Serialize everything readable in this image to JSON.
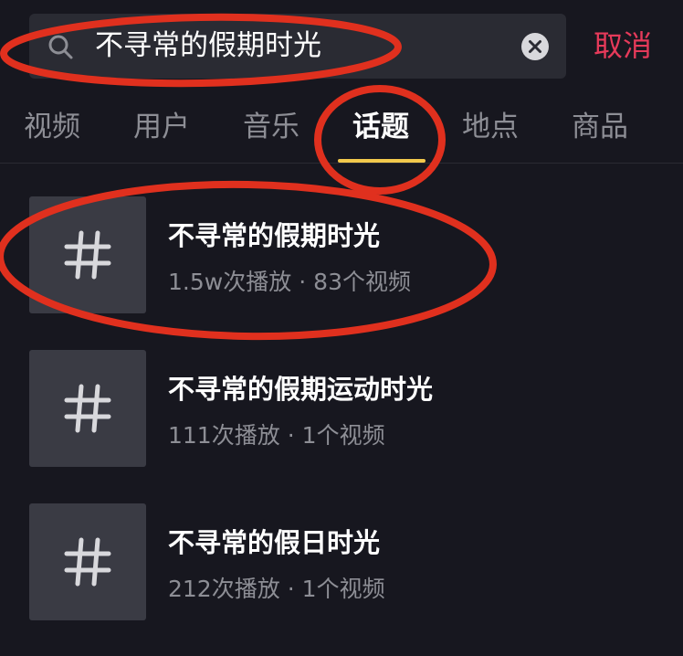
{
  "search": {
    "query": "不寻常的假期时光",
    "cancel_label": "取消"
  },
  "tabs": [
    {
      "label": "视频"
    },
    {
      "label": "用户"
    },
    {
      "label": "音乐"
    },
    {
      "label": "话题"
    },
    {
      "label": "地点"
    },
    {
      "label": "商品"
    }
  ],
  "active_tab": "话题",
  "results": [
    {
      "title": "不寻常的假期时光",
      "plays": "1.5w次播放",
      "separator": "·",
      "videos": "83个视频"
    },
    {
      "title": "不寻常的假期运动时光",
      "plays": "111次播放",
      "separator": "·",
      "videos": "1个视频"
    },
    {
      "title": "不寻常的假日时光",
      "plays": "212次播放",
      "separator": "·",
      "videos": "1个视频"
    }
  ],
  "colors": {
    "background": "#17171f",
    "accent_cancel": "#e63a5a",
    "tab_indicator": "#f2c94c",
    "annotation_red": "#e0301e"
  },
  "icons": {
    "search": "search-icon",
    "clear": "clear-icon",
    "hashtag": "hashtag-icon"
  }
}
